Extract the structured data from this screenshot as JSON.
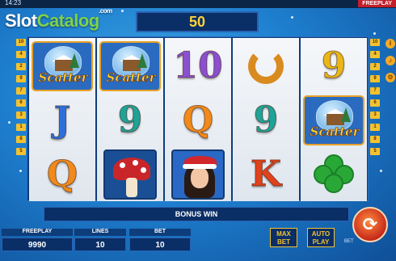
{
  "status_bar": {
    "time": "14:23",
    "mode_tag": "FREEPLAY"
  },
  "logo": {
    "part1": "Slot",
    "part2": "Catalog",
    "suffix": ".com"
  },
  "win_display": {
    "value": "50"
  },
  "reels": [
    [
      "scatter",
      "J",
      "Q"
    ],
    [
      "scatter",
      "9",
      "mushroom"
    ],
    [
      "10",
      "Q",
      "girl"
    ],
    [
      "horseshoe",
      "9",
      "K"
    ],
    [
      "9",
      "scatter",
      "clover"
    ]
  ],
  "scatter_label": "Scatter",
  "paylines": [
    "10",
    "4",
    "2",
    "9",
    "7",
    "6",
    "3",
    "1",
    "8",
    "5"
  ],
  "paylines_right": [
    "10",
    "4",
    "2",
    "9",
    "7",
    "6",
    "3",
    "1",
    "8",
    "5"
  ],
  "settings_icons": [
    "info-icon",
    "volume-icon",
    "gear-icon"
  ],
  "bonus_bar": {
    "text": "BONUS WIN"
  },
  "stats": {
    "freeplay_label": "FREEPLAY",
    "freeplay_value": "9990",
    "lines_label": "LINES",
    "lines_value": "10",
    "bet_label": "BET",
    "bet_value": "10"
  },
  "buttons": {
    "max_bet_l1": "MAX",
    "max_bet_l2": "BET",
    "auto_play_l1": "AUTO",
    "auto_play_l2": "PLAY",
    "side_bet": "BET"
  },
  "colors": {
    "accent": "#f3c22f",
    "panel": "#0a2e66",
    "spin": "#c62a1a"
  }
}
